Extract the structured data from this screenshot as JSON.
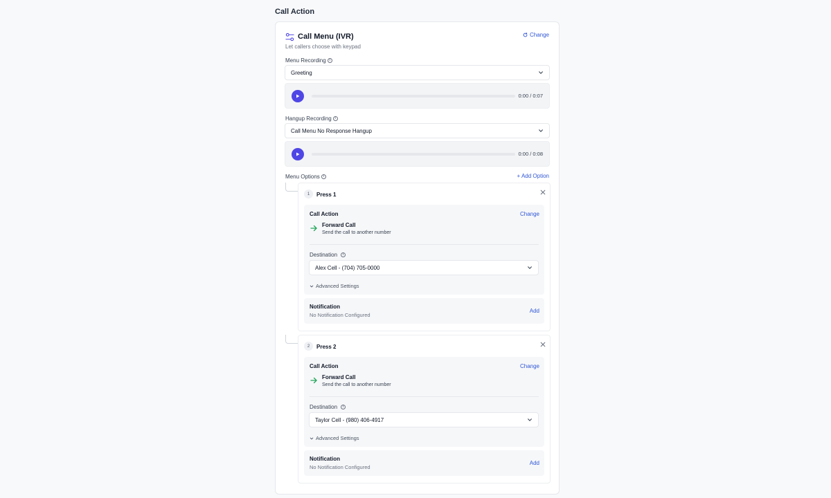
{
  "section_title": "Call Action",
  "header": {
    "title": "Call Menu (IVR)",
    "subtitle": "Let callers choose with keypad",
    "change_label": "Change",
    "icon": "sliders-icon"
  },
  "menu_recording": {
    "label": "Menu Recording",
    "selected": "Greeting",
    "player_time": "0:00 / 0:07"
  },
  "hangup_recording": {
    "label": "Hangup Recording",
    "selected": "Call Menu No Response Hangup",
    "player_time": "0:00 / 0:08"
  },
  "menu_options": {
    "label": "Menu Options",
    "add_label": "+ Add Option",
    "items": [
      {
        "number": "1",
        "title": "Press 1",
        "call_action_label": "Call Action",
        "change_label": "Change",
        "action_title": "Forward Call",
        "action_sub": "Send the call to another number",
        "destination_label": "Destination",
        "destination_value": "Alex Cell - (704) 705-0000",
        "advanced_label": "Advanced Settings",
        "notification_title": "Notification",
        "notification_sub": "No Notification Configured",
        "notification_add": "Add"
      },
      {
        "number": "2",
        "title": "Press 2",
        "call_action_label": "Call Action",
        "change_label": "Change",
        "action_title": "Forward Call",
        "action_sub": "Send the call to another number",
        "destination_label": "Destination",
        "destination_value": "Taylor Cell - (980) 406-4917",
        "advanced_label": "Advanced Settings",
        "notification_title": "Notification",
        "notification_sub": "No Notification Configured",
        "notification_add": "Add"
      }
    ]
  },
  "colors": {
    "accent": "#4f46e5",
    "link": "#2f56d6",
    "forward_arrow": "#22a559"
  }
}
